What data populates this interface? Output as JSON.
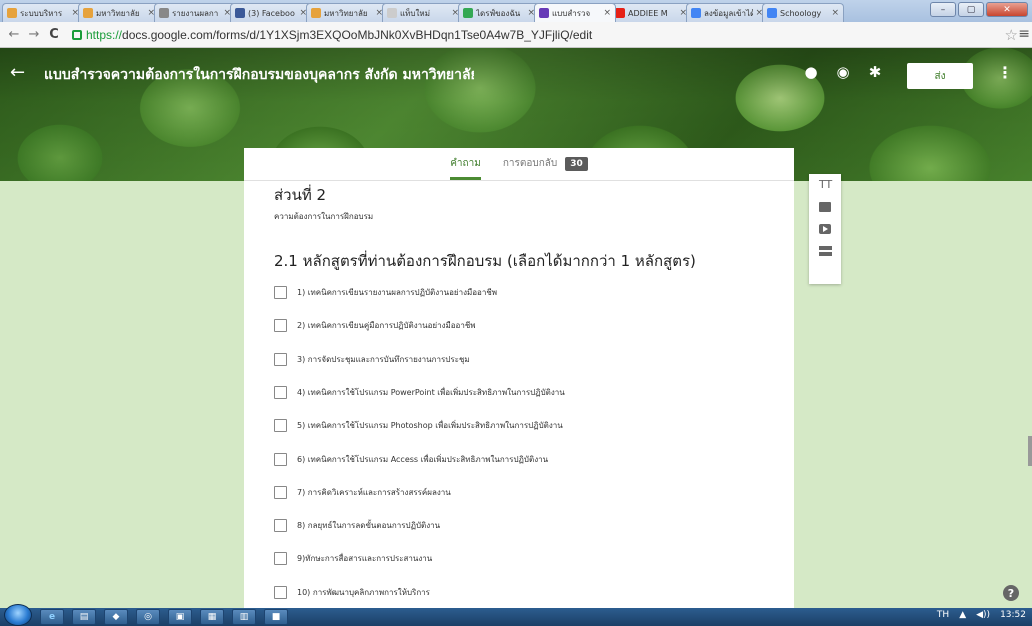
{
  "browser": {
    "tabs": [
      {
        "label": "ระบบบริหาร",
        "color": "#e6a23c"
      },
      {
        "label": "มหาวิทยาลัย",
        "color": "#e6a23c"
      },
      {
        "label": "รายงานผลกา",
        "color": "#888888"
      },
      {
        "label": "(3) Faceboo",
        "color": "#3b5998"
      },
      {
        "label": "มหาวิทยาลัย",
        "color": "#e6a23c"
      },
      {
        "label": "แท็บใหม่",
        "color": "#cccccc"
      },
      {
        "label": "ไดรฟ์ของฉัน",
        "color": "#34a853"
      },
      {
        "label": "แบบสำรวจ",
        "color": "#673ab7"
      },
      {
        "label": "ADDIEE M",
        "color": "#e62117"
      },
      {
        "label": "ลงข้อมูลเข้าได้",
        "color": "#4285f4"
      },
      {
        "label": "Schoology",
        "color": "#4285f4"
      }
    ],
    "active_tab_index": 7,
    "url_scheme": "https://",
    "url_rest": "docs.google.com/forms/d/1Y1XSjm3EXQOoMbJNk0XvBHDqn1Tse0A4w7B_YJFjliQ/edit"
  },
  "header": {
    "title": "แบบสำรวจความต้องการในการฝึกอบรมของบุคลากร สังกัด มหาวิทยาลัยเ",
    "send_label": "ส่ง"
  },
  "form_tabs": {
    "questions_label": "คำถาม",
    "responses_label": "การตอบกลับ",
    "responses_count": "30"
  },
  "section": {
    "title": "ส่วนที่ 2",
    "description": "ความต้องการในการฝึกอบรม"
  },
  "question": {
    "title": "2.1 หลักสูตรที่ท่านต้องการฝึกอบรม (เลือกได้มากกว่า 1 หลักสูตร)",
    "options": [
      "1) เทคนิคการเขียนรายงานผลการปฏิบัติงานอย่างมืออาชีพ",
      "2) เทคนิคการเขียนคู่มือการปฏิบัติงานอย่างมืออาชีพ",
      "3) การจัดประชุมและการบันทึกรายงานการประชุม",
      "4) เทคนิคการใช้โปรแกรม PowerPoint เพื่อเพิ่มประสิทธิภาพในการปฏิบัติงาน",
      "5) เทคนิคการใช้โปรแกรม Photoshop เพื่อเพิ่มประสิทธิภาพในการปฏิบัติงาน",
      "6) เทคนิคการใช้โปรแกรม Access เพื่อเพิ่มประสิทธิภาพในการปฏิบัติงาน",
      "7) การคิดวิเคราะห์และการสร้างสรรค์ผลงาน",
      "8) กลยุทธ์ในการลดขั้นตอนการปฏิบัติงาน",
      "9)ทักษะการสื่อสารและการประสานงาน",
      "10) การพัฒนาบุคลิกภาพการให้บริการ"
    ]
  },
  "sidebar_tools": {
    "title_icon": "TT"
  },
  "taskbar": {
    "language": "TH",
    "clock": "13:52"
  },
  "colors": {
    "page_background": "#d5e9c6",
    "accent": "#4b8b32"
  }
}
